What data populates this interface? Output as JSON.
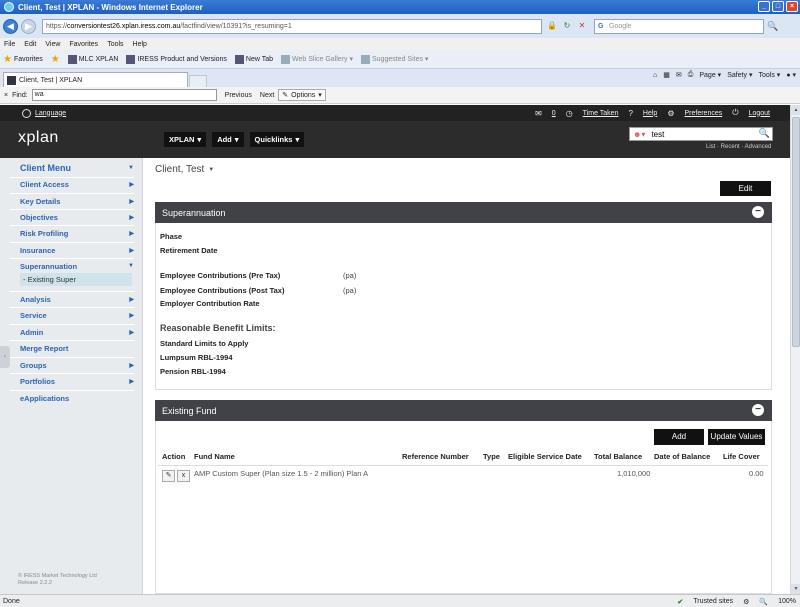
{
  "window": {
    "title": "Client, Test | XPLAN - Windows Internet Explorer",
    "controls": [
      "_",
      "□",
      "×"
    ]
  },
  "address": {
    "url_prefix": "https://",
    "url_host": "conversiontest26.xplan.iress.com.au",
    "url_path": "/factfind/view/10391?is_resuming=1",
    "search_placeholder": "Google"
  },
  "menu": [
    "File",
    "Edit",
    "View",
    "Favorites",
    "Tools",
    "Help"
  ],
  "favorites": {
    "label": "Favorites",
    "items": [
      {
        "label": "MLC XPLAN"
      },
      {
        "label": "IRESS Product and Versions"
      },
      {
        "label": "New Tab"
      },
      {
        "label": "Web Slice Gallery ▾"
      },
      {
        "label": "Suggested Sites ▾"
      }
    ]
  },
  "tab": {
    "label": "Client, Test | XPLAN"
  },
  "commandbar": [
    "Page ▾",
    "Safety ▾",
    "Tools ▾",
    "● ▾"
  ],
  "find": {
    "close": "×",
    "label": "Find:",
    "value": "wa",
    "previous": "Previous",
    "next": "Next",
    "options": "Options"
  },
  "util": {
    "language": "Language",
    "mail_count": "0",
    "time_taken": "Time Taken",
    "help": "Help",
    "preferences": "Preferences",
    "logout": "Logout"
  },
  "header": {
    "logo": "xplan",
    "nav": [
      "XPLAN",
      "Add",
      "Quicklinks"
    ],
    "search_value": "test",
    "search_links": "List · Recent · Advanced"
  },
  "sidebar": {
    "title": "Client Menu",
    "items": [
      {
        "label": "Client Access"
      },
      {
        "label": "Key Details"
      },
      {
        "label": "Objectives"
      },
      {
        "label": "Risk Profiling"
      },
      {
        "label": "Insurance"
      },
      {
        "label": "Superannuation"
      },
      {
        "label": "Analysis"
      },
      {
        "label": "Service"
      },
      {
        "label": "Admin"
      },
      {
        "label": "Merge Report"
      },
      {
        "label": "Groups"
      },
      {
        "label": "Portfolios"
      },
      {
        "label": "eApplications"
      }
    ],
    "sub_item": "- Existing Super",
    "footer_line1": "© IRESS Market Technology Ltd",
    "footer_line2": "Release 2.2.2"
  },
  "main": {
    "client_name": "Client, Test",
    "edit_label": "Edit",
    "super_panel": {
      "title": "Superannuation",
      "fields": [
        {
          "label": "Phase"
        },
        {
          "label": "Retirement Date"
        },
        {
          "label": "Employee Contributions (Pre Tax)",
          "unit": "(pa)"
        },
        {
          "label": "Employee Contributions (Post Tax)",
          "unit": "(pa)"
        },
        {
          "label": "Employer Contribution Rate"
        }
      ],
      "rbl_title": "Reasonable Benefit Limits:",
      "rbl_fields": [
        {
          "label": "Standard Limits to Apply"
        },
        {
          "label": "Lumpsum RBL-1994"
        },
        {
          "label": "Pension RBL-1994"
        }
      ]
    },
    "fund_panel": {
      "title": "Existing Fund",
      "add_label": "Add",
      "update_label": "Update Values",
      "columns": [
        "Action",
        "Fund Name",
        "Reference Number",
        "Type",
        "Eligible Service Date",
        "Total Balance",
        "Date of Balance",
        "Life Cover"
      ],
      "rows": [
        {
          "fund_name": "AMP Custom Super (Plan size 1.5 - 2 million) Plan A",
          "total_balance": "1,010,000",
          "life_cover": "0.00"
        }
      ]
    }
  },
  "status": {
    "left": "Done",
    "trusted": "Trusted sites",
    "zoom": "100%"
  }
}
